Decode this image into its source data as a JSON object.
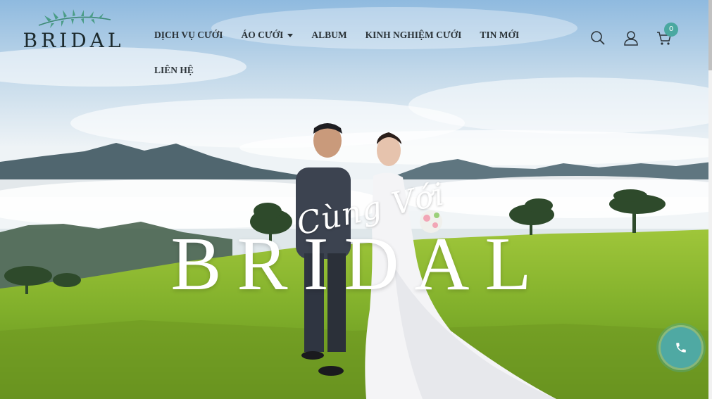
{
  "brand": {
    "logo_text": "BRIDAL",
    "accent_color": "#4aa8a0",
    "text_color": "#2b3338"
  },
  "nav": {
    "items": [
      {
        "label": "DỊCH VỤ CƯỚI",
        "has_dropdown": false
      },
      {
        "label": "ÁO CƯỚI",
        "has_dropdown": true
      },
      {
        "label": "ALBUM",
        "has_dropdown": false
      },
      {
        "label": "KINH NGHIỆM CƯỚI",
        "has_dropdown": false
      },
      {
        "label": "TIN MỚI",
        "has_dropdown": false
      },
      {
        "label": "LIÊN HỆ",
        "has_dropdown": false
      }
    ]
  },
  "header_icons": {
    "search": "search-icon",
    "account": "user-icon",
    "cart": "cart-icon",
    "cart_count": "0"
  },
  "hero": {
    "script_text": "Cùng Với",
    "title": "BRIDAL"
  },
  "call_button": {
    "icon": "phone-icon",
    "color": "#4fa9a3"
  }
}
